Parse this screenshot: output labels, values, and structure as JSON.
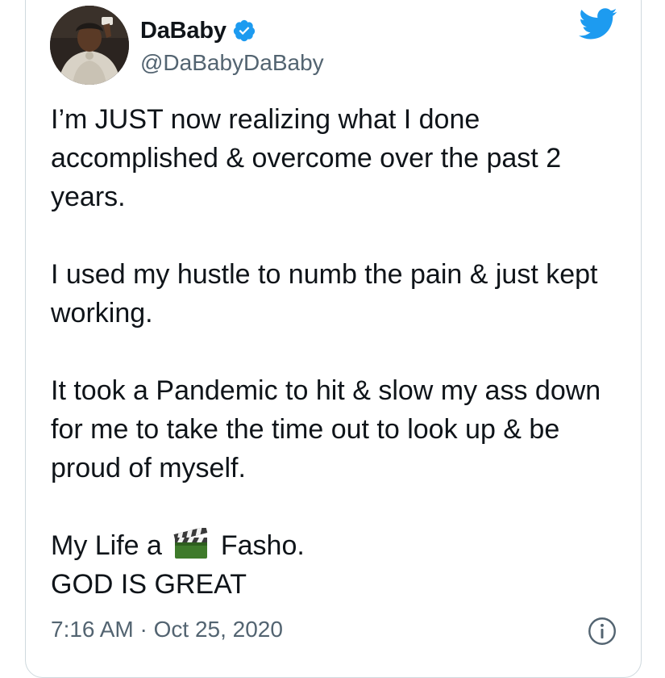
{
  "user": {
    "display_name": "DaBaby",
    "handle": "@DaBabyDaBaby",
    "verified": true,
    "avatar_icon": "profile-photo"
  },
  "tweet": {
    "paragraph_1": "I’m JUST now realizing what I done accomplished & overcome over the past 2 years.",
    "paragraph_2": "I used my hustle to numb the pain & just kept working.",
    "paragraph_3": "It took a Pandemic to hit & slow my ass down for me to take the time out to look up & be proud of myself.",
    "line_4a": "My Life a",
    "emoji_icon": "clapper-board-emoji",
    "line_4b": "Fasho.",
    "line_5": "GOD IS GREAT"
  },
  "meta": {
    "time": "7:16 AM",
    "separator": "·",
    "date": "Oct 25, 2020"
  },
  "icons": {
    "brand": "twitter-bird-icon",
    "info": "info-icon",
    "verified": "verified-badge-icon"
  },
  "colors": {
    "twitter_blue": "#1d9bf0",
    "text_primary": "#0f1419",
    "text_secondary": "#536471",
    "border": "#cfd9de"
  }
}
